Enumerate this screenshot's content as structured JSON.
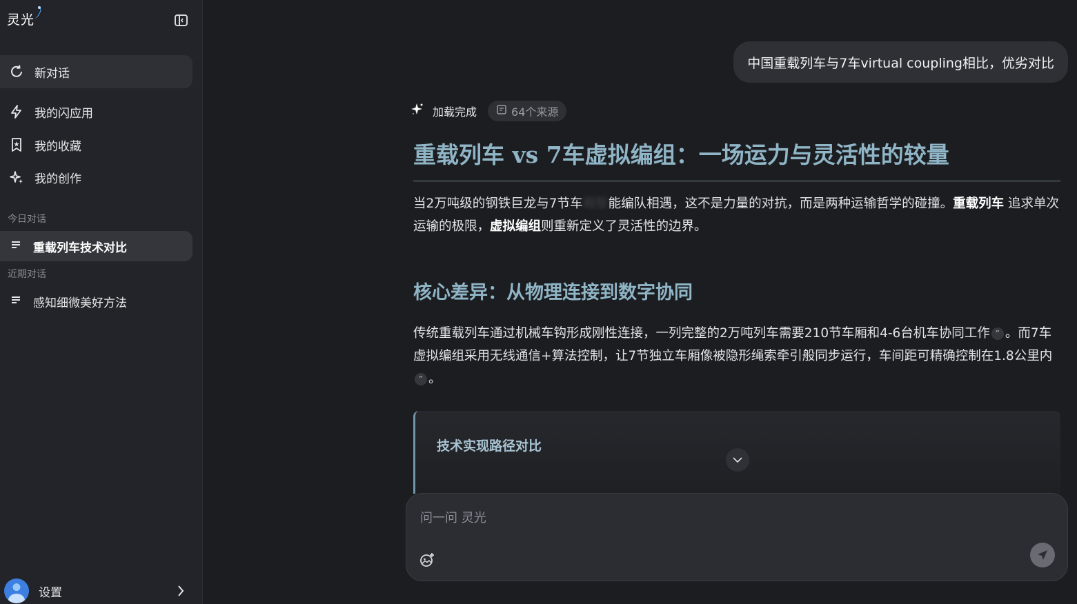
{
  "app": {
    "logo_text": "灵光"
  },
  "sidebar": {
    "new_chat_label": "新对话",
    "nav_items": [
      {
        "label": "我的闪应用",
        "icon": "lightning-apps-icon"
      },
      {
        "label": "我的收藏",
        "icon": "bookmark-star-icon"
      },
      {
        "label": "我的创作",
        "icon": "sparkle-create-icon"
      }
    ],
    "today_label": "今日对话",
    "today_conversations": [
      {
        "label": "重载列车技术对比",
        "active": true
      }
    ],
    "recent_label": "近期对话",
    "recent_conversations": [
      {
        "label": "感知细微美好方法",
        "active": false
      }
    ],
    "settings_label": "设置"
  },
  "chat": {
    "user_message": "中国重载列车与7车virtual coupling相比，优劣对比",
    "status_text": "加载完成",
    "sources_label": "64个来源",
    "answer": {
      "title": "重载列车 vs 7车虚拟编组：一场运力与灵活性的较量",
      "intro_part1": "当2万吨级的钢铁巨龙与7节车",
      "intro_blurred": "厢智",
      "intro_part2": "能编队相遇，这不是力量的对抗，而是两种运输哲学的碰撞。",
      "intro_bold1": "重载列车",
      "intro_part3": " 追求单次运输的极限，",
      "intro_bold2": "虚拟编组",
      "intro_part4": "则重新定义了灵活性的边界。",
      "section_heading": "核心差异：从物理连接到数字协同",
      "body_part1": "传统重载列车通过机械车钩形成刚性连接，一列完整的2万吨列车需要210节车厢和4-6台机车协同工作",
      "body_part2": "。而7车虚拟编组采用无线通信+算法控制，让7节独立车厢像被隐形绳索牵引般同步运行，车间距可精确控制在1.8公里内",
      "body_part3": "。",
      "collapsible_title": "技术实现路径对比"
    }
  },
  "composer": {
    "placeholder": "问一问 灵光"
  },
  "colors": {
    "accent_heading": "#8fb5c6",
    "background": "#1c1d21",
    "sidebar": "#232429"
  }
}
